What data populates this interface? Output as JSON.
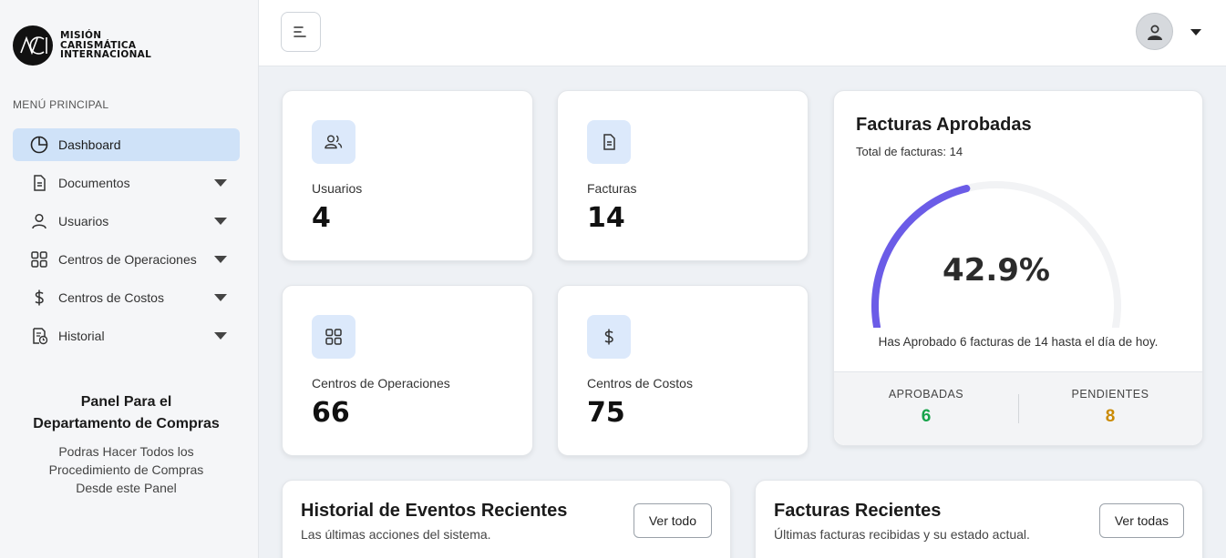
{
  "brand": {
    "logo_text": "MCI",
    "name_lines": [
      "MISIÓN",
      "CARISMÁTICA",
      "INTERNACIONAL"
    ]
  },
  "sidebar": {
    "menu_title": "MENÚ PRINCIPAL",
    "items": [
      {
        "label": "Dashboard",
        "icon": "pie-chart-icon",
        "active": true
      },
      {
        "label": "Documentos",
        "icon": "document-icon"
      },
      {
        "label": "Usuarios",
        "icon": "user-icon"
      },
      {
        "label": "Centros de Operaciones",
        "icon": "grid-icon"
      },
      {
        "label": "Centros de Costos",
        "icon": "dollar-icon"
      },
      {
        "label": "Historial",
        "icon": "history-icon"
      }
    ],
    "panel": {
      "title_line1": "Panel Para el",
      "title_line2": "Departamento de Compras",
      "desc_line1": "Podras Hacer Todos los",
      "desc_line2": "Procedimiento de Compras",
      "desc_line3": "Desde este Panel"
    }
  },
  "stats": [
    {
      "label": "Usuarios",
      "value": "4",
      "icon": "users-icon"
    },
    {
      "label": "Facturas",
      "value": "14",
      "icon": "invoice-icon"
    },
    {
      "label": "Centros de Operaciones",
      "value": "66",
      "icon": "grid-icon"
    },
    {
      "label": "Centros de Costos",
      "value": "75",
      "icon": "dollar-icon"
    }
  ],
  "approved": {
    "title": "Facturas Aprobadas",
    "subtitle": "Total de facturas: 14",
    "percent_text": "42.9%",
    "percent_value": 42.9,
    "caption": "Has Aprobado 6 facturas de 14 hasta el día de hoy.",
    "approved_label": "APROBADAS",
    "approved_value": "6",
    "pending_label": "PENDIENTES",
    "pending_value": "8",
    "colors": {
      "arc": "#6b5ce7",
      "track": "#f2f3f5",
      "approved": "#16a34a",
      "pending": "#ca8a04"
    }
  },
  "history": {
    "title": "Historial de Eventos Recientes",
    "subtitle": "Las últimas acciones del sistema.",
    "button": "Ver todo"
  },
  "recent": {
    "title": "Facturas Recientes",
    "subtitle": "Últimas facturas recibidas y su estado actual.",
    "button": "Ver todas"
  },
  "colors": {
    "accent": "#cfe2f8",
    "icon_bg": "#dce9fb"
  }
}
